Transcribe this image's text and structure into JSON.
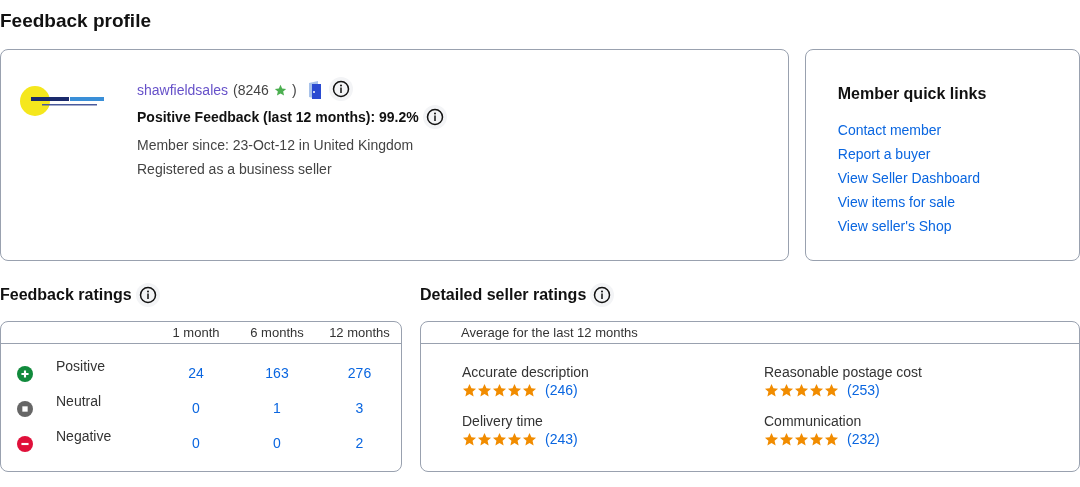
{
  "title": "Feedback profile",
  "profile": {
    "username": "shawfieldsales",
    "score": "(8246",
    "score_close": ")",
    "positive": "Positive Feedback (last 12 months): 99.2%",
    "member_since": "Member since: 23-Oct-12 in United Kingdom",
    "registered": "Registered as a business seller"
  },
  "quick_links": {
    "title": "Member quick links",
    "links": [
      "Contact member",
      "Report a buyer",
      "View Seller Dashboard",
      "View items for sale",
      "View seller's Shop"
    ]
  },
  "feedback_ratings": {
    "title": "Feedback ratings",
    "columns": [
      "1 month",
      "6 months",
      "12 months"
    ],
    "rows": [
      {
        "kind": "positive",
        "label": "Positive",
        "values": [
          "24",
          "163",
          "276"
        ]
      },
      {
        "kind": "neutral",
        "label": "Neutral",
        "values": [
          "0",
          "1",
          "3"
        ]
      },
      {
        "kind": "negative",
        "label": "Negative",
        "values": [
          "0",
          "0",
          "2"
        ]
      }
    ]
  },
  "detailed_ratings": {
    "title": "Detailed seller ratings",
    "subtitle": "Average for the last 12 months",
    "items": [
      {
        "label": "Accurate description",
        "stars": 5,
        "count": "(246)"
      },
      {
        "label": "Reasonable postage cost",
        "stars": 5,
        "count": "(253)"
      },
      {
        "label": "Delivery time",
        "stars": 5,
        "count": "(243)"
      },
      {
        "label": "Communication",
        "stars": 5,
        "count": "(232)"
      }
    ]
  }
}
